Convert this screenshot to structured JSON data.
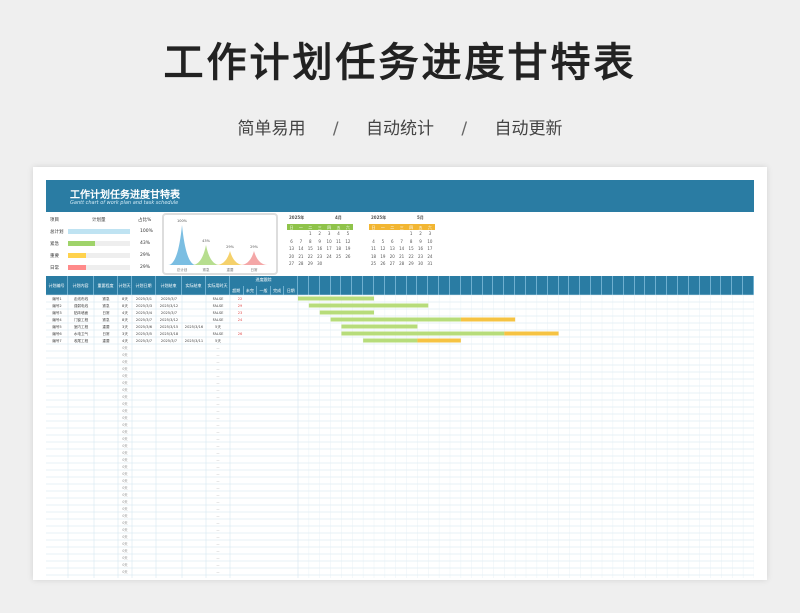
{
  "hero": {
    "title": "工作计划任务进度甘特表",
    "subtitle": [
      "简单易用",
      "自动统计",
      "自动更新"
    ],
    "separator": "/"
  },
  "banner": {
    "title": "工作计划任务进度甘特表",
    "subtitle": "Gantt chart of work plan and task schedule"
  },
  "stats": {
    "headers": [
      "项目",
      "计划量",
      "占比%"
    ],
    "rows": [
      {
        "label": "总计划",
        "value": "100%",
        "fraction": 1.0,
        "color": "#bfe3f2"
      },
      {
        "label": "紧急",
        "value": "43%",
        "fraction": 0.43,
        "color": "#9fd36a"
      },
      {
        "label": "重要",
        "value": "29%",
        "fraction": 0.29,
        "color": "#ffd24d"
      },
      {
        "label": "日常",
        "value": "29%",
        "fraction": 0.29,
        "color": "#ff8a8a"
      }
    ]
  },
  "peak_labels": [
    "100%",
    "43%",
    "29%",
    "29%"
  ],
  "chart_legend": [
    "总计划",
    "紧急",
    "重要",
    "日常"
  ],
  "calendars": [
    {
      "year": "2025年",
      "month": "4月",
      "header_color": "#8fc34a",
      "weekdays": [
        "日",
        "一",
        "二",
        "三",
        "四",
        "五",
        "六"
      ],
      "days": [
        "",
        "",
        "1",
        "2",
        "3",
        "4",
        "5",
        "6",
        "7",
        "8",
        "9",
        "10",
        "11",
        "12",
        "13",
        "14",
        "15",
        "16",
        "17",
        "18",
        "19",
        "20",
        "21",
        "22",
        "23",
        "24",
        "25",
        "26",
        "27",
        "28",
        "29",
        "30"
      ]
    },
    {
      "year": "2025年",
      "month": "5月",
      "header_color": "#f2b632",
      "weekdays": [
        "日",
        "一",
        "二",
        "三",
        "四",
        "五",
        "六"
      ],
      "days": [
        "",
        "",
        "",
        "",
        "1",
        "2",
        "3",
        "4",
        "5",
        "6",
        "7",
        "8",
        "9",
        "10",
        "11",
        "12",
        "13",
        "14",
        "15",
        "16",
        "17",
        "18",
        "19",
        "20",
        "21",
        "22",
        "23",
        "24",
        "25",
        "26",
        "27",
        "28",
        "29",
        "30",
        "31"
      ]
    }
  ],
  "table": {
    "headers": [
      "计划编号",
      "计划内容",
      "重要程度",
      "计划天数",
      "计划日期",
      "计划结束",
      "实际结束",
      "实际用时天数",
      "进度跟踪"
    ],
    "progress_sub": [
      "超期",
      "未完",
      "一般",
      "完成",
      "日期"
    ],
    "rows": [
      {
        "id": "编号1",
        "content": "走线布线",
        "level": "紧急",
        "days": "8天",
        "start": "2025/3/1",
        "end": "2025/3/7",
        "actual_end": "",
        "used": "FALSE",
        "flag": "22"
      },
      {
        "id": "编号2",
        "content": "强弱电线",
        "level": "紧急",
        "days": "8天",
        "start": "2025/3/3",
        "end": "2025/3/12",
        "actual_end": "",
        "used": "FALSE",
        "flag": "29"
      },
      {
        "id": "编号3",
        "content": "贴砖墙面",
        "level": "日常",
        "days": "4天",
        "start": "2025/3/4",
        "end": "2025/3/7",
        "actual_end": "",
        "used": "FALSE",
        "flag": "23"
      },
      {
        "id": "编号4",
        "content": "门窗工程",
        "level": "紧急",
        "days": "8天",
        "start": "2025/3/7",
        "end": "2025/3/12",
        "actual_end": "",
        "used": "FALSE",
        "flag": "24"
      },
      {
        "id": "编号5",
        "content": "室内工程",
        "level": "重要",
        "days": "3天",
        "start": "2025/3/6",
        "end": "2025/3/15",
        "actual_end": "2025/3/16",
        "used": "5天",
        "flag": ""
      },
      {
        "id": "编号6",
        "content": "水电卫气",
        "level": "日常",
        "days": "3天",
        "start": "2025/3/5",
        "end": "2025/3/18",
        "actual_end": "",
        "used": "FALSE",
        "flag": "26"
      },
      {
        "id": "编号7",
        "content": "收尾工程",
        "level": "重要",
        "days": "4天",
        "start": "2025/3/7",
        "end": "2025/3/7",
        "actual_end": "2025/3/11",
        "used": "5天",
        "flag": ""
      }
    ],
    "empty_days": "0天",
    "empty_used": "—"
  },
  "gantt": {
    "bars": [
      {
        "row": 0,
        "start": 0,
        "green": 14,
        "yellow": 0
      },
      {
        "row": 1,
        "start": 2,
        "green": 22,
        "yellow": 0
      },
      {
        "row": 2,
        "start": 4,
        "green": 10,
        "yellow": 0
      },
      {
        "row": 3,
        "start": 6,
        "green": 24,
        "yellow": 10
      },
      {
        "row": 4,
        "start": 8,
        "green": 14,
        "yellow": 0
      },
      {
        "row": 5,
        "start": 8,
        "green": 30,
        "yellow": 10
      },
      {
        "row": 6,
        "start": 12,
        "green": 10,
        "yellow": 8
      }
    ],
    "green": "#b7dc7a",
    "yellow": "#f6c343"
  }
}
